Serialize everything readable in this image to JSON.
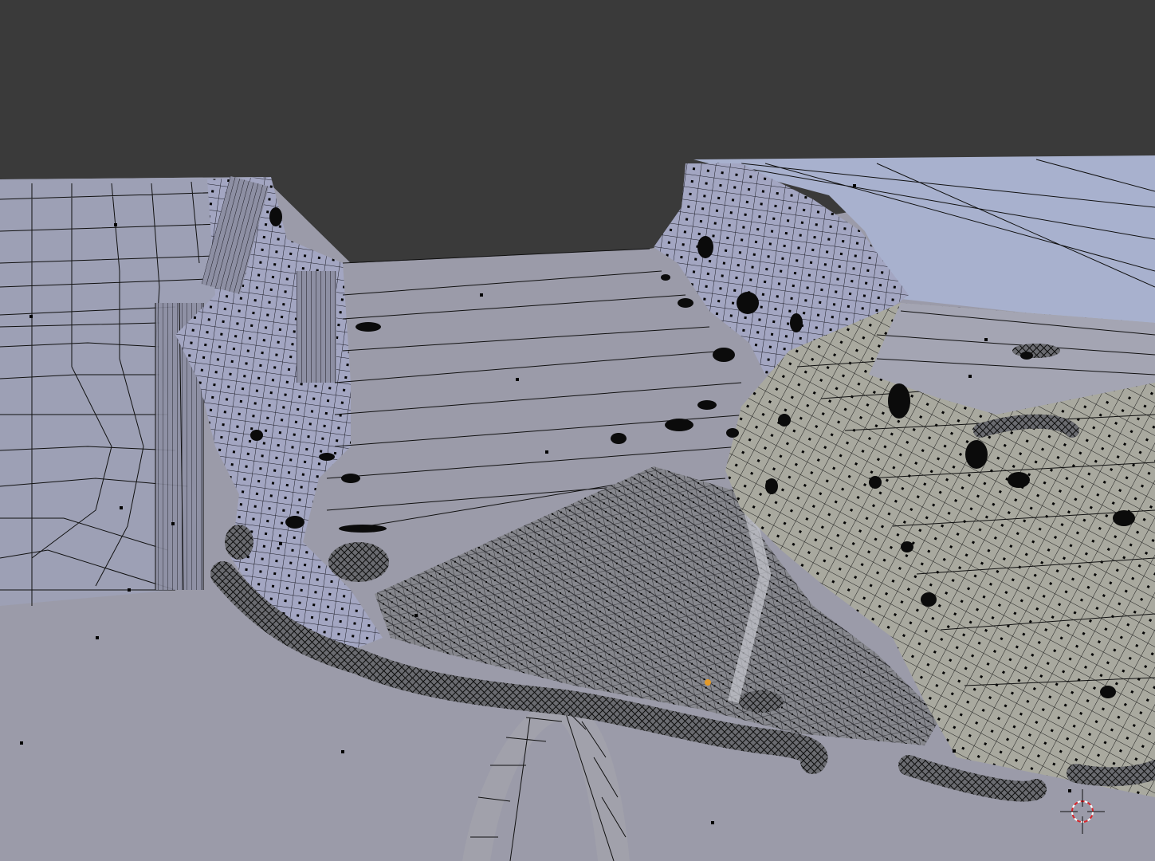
{
  "viewport": {
    "mode": "edit-mode-wireframe",
    "colors": {
      "background": "#3a3a3a",
      "ground": "#9a9aa8",
      "cliff_left": "#9ea0b6",
      "cliff_right": "#a7adc9",
      "far_plane": "#a9b2cf",
      "rock_mass": "#a8a89e",
      "dense_grid": "#77787e",
      "wire": "#101010",
      "vertex": "#000000",
      "selected_vertex": "#e39a2a",
      "cursor_red": "#d8242a",
      "cursor_white": "#ffffff"
    },
    "icons": {
      "cursor": "3d-cursor-icon",
      "origin": "object-origin-icon"
    }
  }
}
